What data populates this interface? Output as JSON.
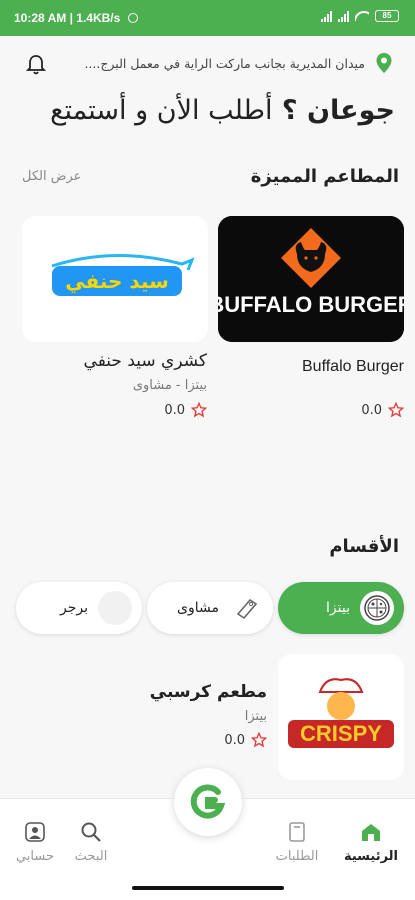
{
  "status": {
    "time": "10:28 AM",
    "speed": "1.4KB/s",
    "battery": "85"
  },
  "header": {
    "location": "ميدان المديرية بجانب ماركت الراية في معمل البرج....",
    "hero_bold": "جوعان ؟",
    "hero_rest": "أطلب الأن و أستمتع"
  },
  "featured": {
    "title": "المطاعم المميزة",
    "view_all": "عرض الكل",
    "restaurants": [
      {
        "name": "Buffalo Burger",
        "category": "",
        "rating": "0.0",
        "logo_text": "BUFFALO BURGER"
      },
      {
        "name": "كشري سيد حنفي",
        "category": "بيتزا - مشاوى",
        "rating": "0.0",
        "logo_text": "سيد حنفي"
      }
    ]
  },
  "categories": {
    "title": "الأقسام",
    "items": [
      {
        "label": "بيتزا",
        "icon": "pizza-icon"
      },
      {
        "label": "مشاوى",
        "icon": "tag-icon"
      },
      {
        "label": "برجر",
        "icon": "burger-icon"
      }
    ]
  },
  "restaurant_list": [
    {
      "name": "مطعم كرسبي",
      "category": "بيتزا",
      "rating": "0.0",
      "logo_text": "CRISPY"
    }
  ],
  "nav": {
    "home": "الرئيسية",
    "orders": "الطلبات",
    "search": "البحث",
    "account": "حسابي"
  },
  "colors": {
    "primary": "#4caf50",
    "star": "#e53935"
  }
}
